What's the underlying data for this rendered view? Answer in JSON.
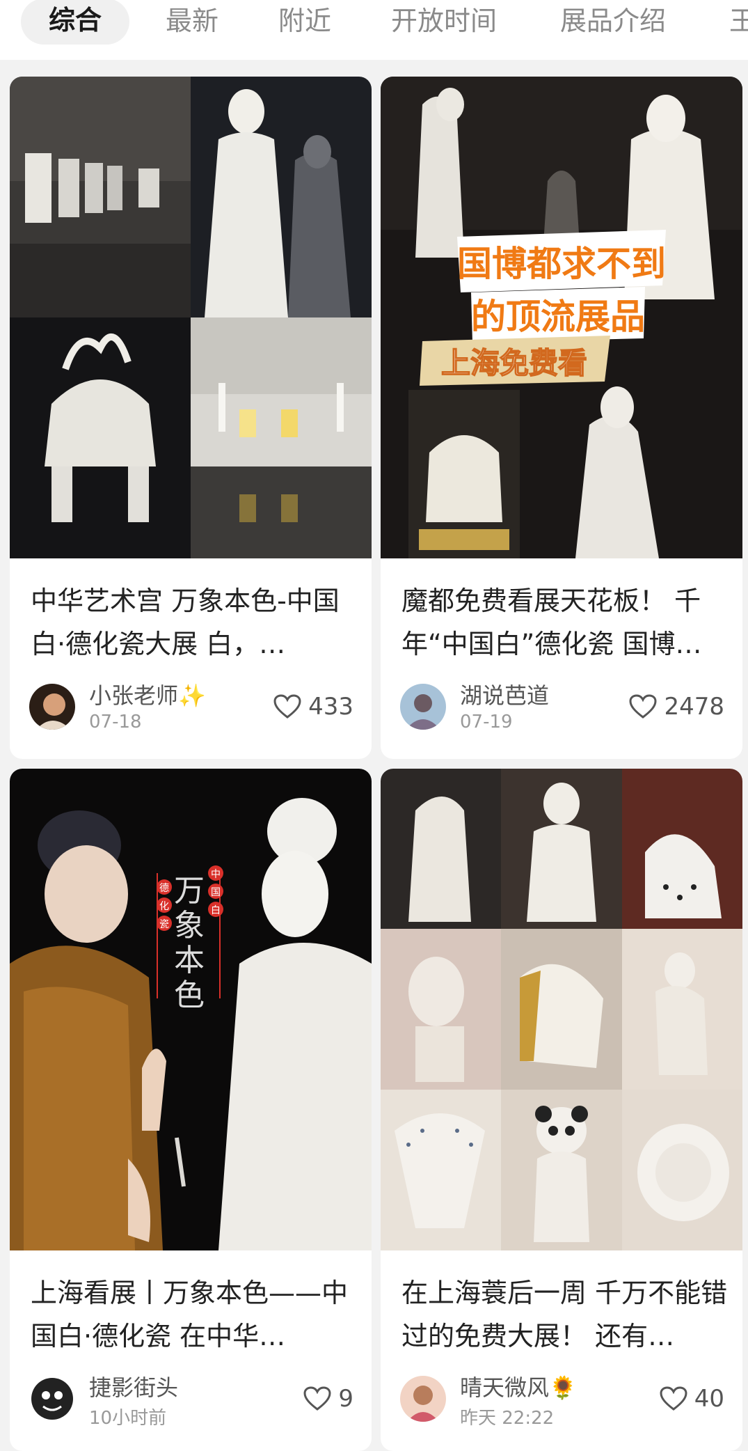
{
  "tabs": [
    {
      "label": "综合",
      "active": true
    },
    {
      "label": "最新",
      "active": false
    },
    {
      "label": "附近",
      "active": false
    },
    {
      "label": "开放时间",
      "active": false
    },
    {
      "label": "展品介绍",
      "active": false
    },
    {
      "label": "王",
      "active": false
    }
  ],
  "cards": [
    {
      "title": "中华艺术宫 万象本色-中国白·德化瓷大展 白，…",
      "author": "小张老师✨",
      "date": "07-18",
      "likes": "433",
      "image_text": []
    },
    {
      "title": "魔都免费看展天花板！ 千年“中国白”德化瓷 国博…",
      "author": "湖说芭道",
      "date": "07-19",
      "likes": "2478",
      "image_text": {
        "line1": "国博都求不到",
        "line2": "的顶流展品",
        "line3": "上海免费看"
      }
    },
    {
      "title": "上海看展丨万象本色——中国白·德化瓷 在中华…",
      "author": "捷影街头",
      "date": "10小时前",
      "likes": "9",
      "image_text": {
        "main": "万象本色",
        "seal_left": "德化瓷",
        "seal_right": "中国白"
      }
    },
    {
      "title": "在上海蓑后一周 千万不能错过的免费大展！ 还有…",
      "author": "晴天微风🌻",
      "date": "昨天 22:22",
      "likes": "40",
      "image_text": []
    }
  ],
  "colors": {
    "accent_red": "#d9302a",
    "overlay_orange": "#f07a14",
    "like_icon": "#555555"
  },
  "icons": [
    "heart-outline-icon"
  ]
}
